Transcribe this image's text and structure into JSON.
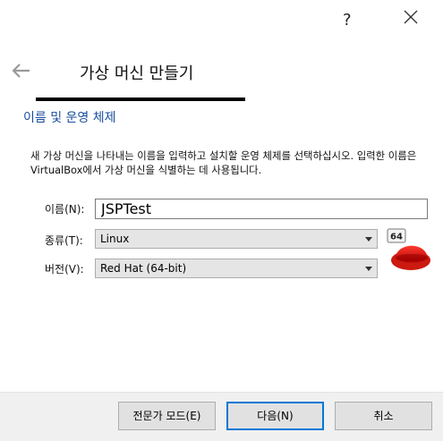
{
  "window": {
    "help_glyph": "?",
    "close_glyph": "✕"
  },
  "wizard": {
    "title": "가상 머신 만들기",
    "section_title": "이름 및 운영 체제",
    "description": "새 가상 머신을 나타내는 이름을 입력하고 설치할 운영 체제를 선택하십시오. 입력한 이름은 VirtualBox에서 가상 머신을 식별하는 데 사용됩니다."
  },
  "form": {
    "name_label": "이름(N):",
    "name_value": "JSPTest",
    "type_label": "종류(T):",
    "type_value": "Linux",
    "version_label": "버전(V):",
    "version_value": "Red Hat (64-bit)",
    "os_icon_badge": "64"
  },
  "buttons": {
    "expert": "전문가 모드(E)",
    "next": "다음(N)",
    "cancel": "취소"
  },
  "colors": {
    "section_title": "#1a4e9c",
    "primary_border": "#0078d7",
    "footer_bg": "#f0f0f0"
  }
}
